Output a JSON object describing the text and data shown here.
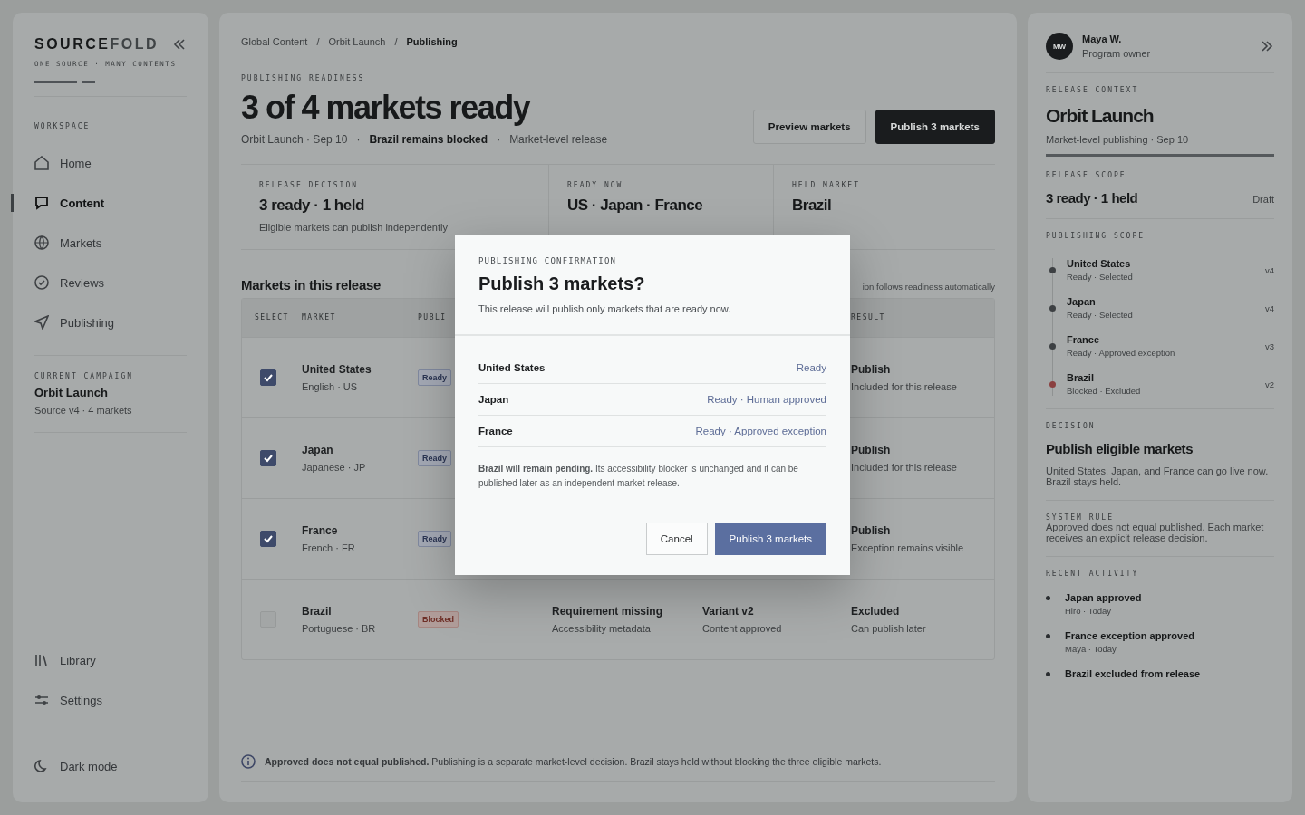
{
  "sidebar": {
    "logo": {
      "strong": "SOURCE",
      "light": "FOLD"
    },
    "tagline": "ONE SOURCE · MANY CONTENTS",
    "section_label": "WORKSPACE",
    "items": [
      {
        "label": "Home",
        "selected": false
      },
      {
        "label": "Content",
        "selected": true
      },
      {
        "label": "Markets",
        "selected": false
      },
      {
        "label": "Reviews",
        "selected": false
      },
      {
        "label": "Publishing",
        "selected": false
      }
    ],
    "campaign": {
      "label": "CURRENT CAMPAIGN",
      "title": "Orbit Launch",
      "meta": "Source v4 · 4 markets"
    },
    "bottom_items": [
      {
        "label": "Library"
      },
      {
        "label": "Settings"
      }
    ],
    "theme_toggle": "Dark mode"
  },
  "main": {
    "breadcrumbs": [
      {
        "label": "Global Content",
        "current": false
      },
      {
        "label": "Orbit Launch",
        "current": false
      },
      {
        "label": "Publishing",
        "current": true
      }
    ],
    "breadcrumb_separator": "/",
    "eyebrow": "PUBLISHING READINESS",
    "title": "3 of 4 markets ready",
    "meta": [
      {
        "text": "Orbit Launch · Sep 10",
        "emphasis": false
      },
      {
        "text": "Brazil remains blocked",
        "emphasis": true
      },
      {
        "text": "Market-level release",
        "emphasis": false
      }
    ],
    "meta_separator": "·",
    "actions": [
      {
        "label": "Preview markets",
        "primary": false
      },
      {
        "label": "Publish 3 markets",
        "primary": true
      }
    ],
    "stats": [
      {
        "label": "RELEASE DECISION",
        "value": "3 ready · 1 held",
        "note": "Eligible markets can publish independently"
      },
      {
        "label": "READY NOW",
        "value": "US · Japan · France"
      },
      {
        "label": "HELD MARKET",
        "value": "Brazil"
      }
    ],
    "table_title": "Markets in this release",
    "table_note": "ion follows readiness automatically",
    "table": {
      "columns": [
        "SELECT",
        "MARKET",
        "PUBLI",
        "RESULT"
      ],
      "rows": [
        {
          "checked": true,
          "market": "United States",
          "locale": "English · US",
          "badge": "Ready",
          "kind": "ready",
          "result": "Publish",
          "result_note": "Included for this release"
        },
        {
          "checked": true,
          "market": "Japan",
          "locale": "Japanese · JP",
          "badge": "Ready",
          "kind": "ready",
          "result": "Publish",
          "result_note": "Included for this release"
        },
        {
          "checked": true,
          "market": "France",
          "locale": "French · FR",
          "badge": "Ready",
          "kind": "ready",
          "result": "Publish",
          "result_note": "Exception remains visible"
        },
        {
          "checked": false,
          "market": "Brazil",
          "locale": "Portuguese · BR",
          "badge": "Blocked",
          "kind": "blocked",
          "requirement": "Requirement missing",
          "requirement_note": "Accessibility metadata",
          "variant": "Variant v2",
          "variant_note": "Content approved",
          "result": "Excluded",
          "result_note": "Can publish later"
        }
      ]
    },
    "footer_note": "**Approved does not equal published.** Publishing is a separate market-level decision. Brazil stays held without blocking the three eligible markets."
  },
  "panel": {
    "user": {
      "initials": "MW",
      "name": "Maya W.",
      "role": "Program owner"
    },
    "context": {
      "label": "RELEASE CONTEXT",
      "title": "Orbit Launch",
      "meta": "Market-level publishing · Sep 10"
    },
    "scope": {
      "label": "RELEASE SCOPE",
      "value": "3 ready · 1 held",
      "tag": "Draft"
    },
    "publishing_label": "PUBLISHING SCOPE",
    "markets": [
      {
        "name": "United States",
        "status": "Ready · Selected",
        "version": "v4",
        "color": "#3d4043"
      },
      {
        "name": "Japan",
        "status": "Ready · Selected",
        "version": "v4",
        "color": "#3d4043"
      },
      {
        "name": "France",
        "status": "Ready · Approved exception",
        "version": "v3",
        "color": "#3d4043"
      },
      {
        "name": "Brazil",
        "status": "Blocked · Excluded",
        "version": "v2",
        "color": "#8a3f3f"
      }
    ],
    "decision": {
      "label": "DECISION",
      "title": "Publish eligible markets",
      "text": "United States, Japan, and France can go live now. Brazil stays held."
    },
    "rule": {
      "label": "SYSTEM RULE",
      "text": "Approved does not equal published. Each market receives an explicit release decision."
    },
    "activity_label": "RECENT ACTIVITY",
    "activity": [
      {
        "title": "Japan approved",
        "meta": "Hiro · Today"
      },
      {
        "title": "France exception approved",
        "meta": "Maya · Today"
      },
      {
        "title": "Brazil excluded from release"
      }
    ]
  },
  "modal": {
    "eyebrow": "PUBLISHING CONFIRMATION",
    "title": "Publish 3 markets?",
    "subtitle": "This release will publish only markets that are ready now.",
    "rows": [
      {
        "market": "United States",
        "status": "Ready"
      },
      {
        "market": "Japan",
        "status": "Ready · Human approved"
      },
      {
        "market": "France",
        "status": "Ready · Approved exception"
      }
    ],
    "note": "**Brazil will remain pending.** Its accessibility blocker is unchanged and it can be published later as an independent market release.",
    "buttons": [
      {
        "label": "Cancel",
        "primary": false
      },
      {
        "label": "Publish 3 markets",
        "primary": true
      }
    ]
  }
}
